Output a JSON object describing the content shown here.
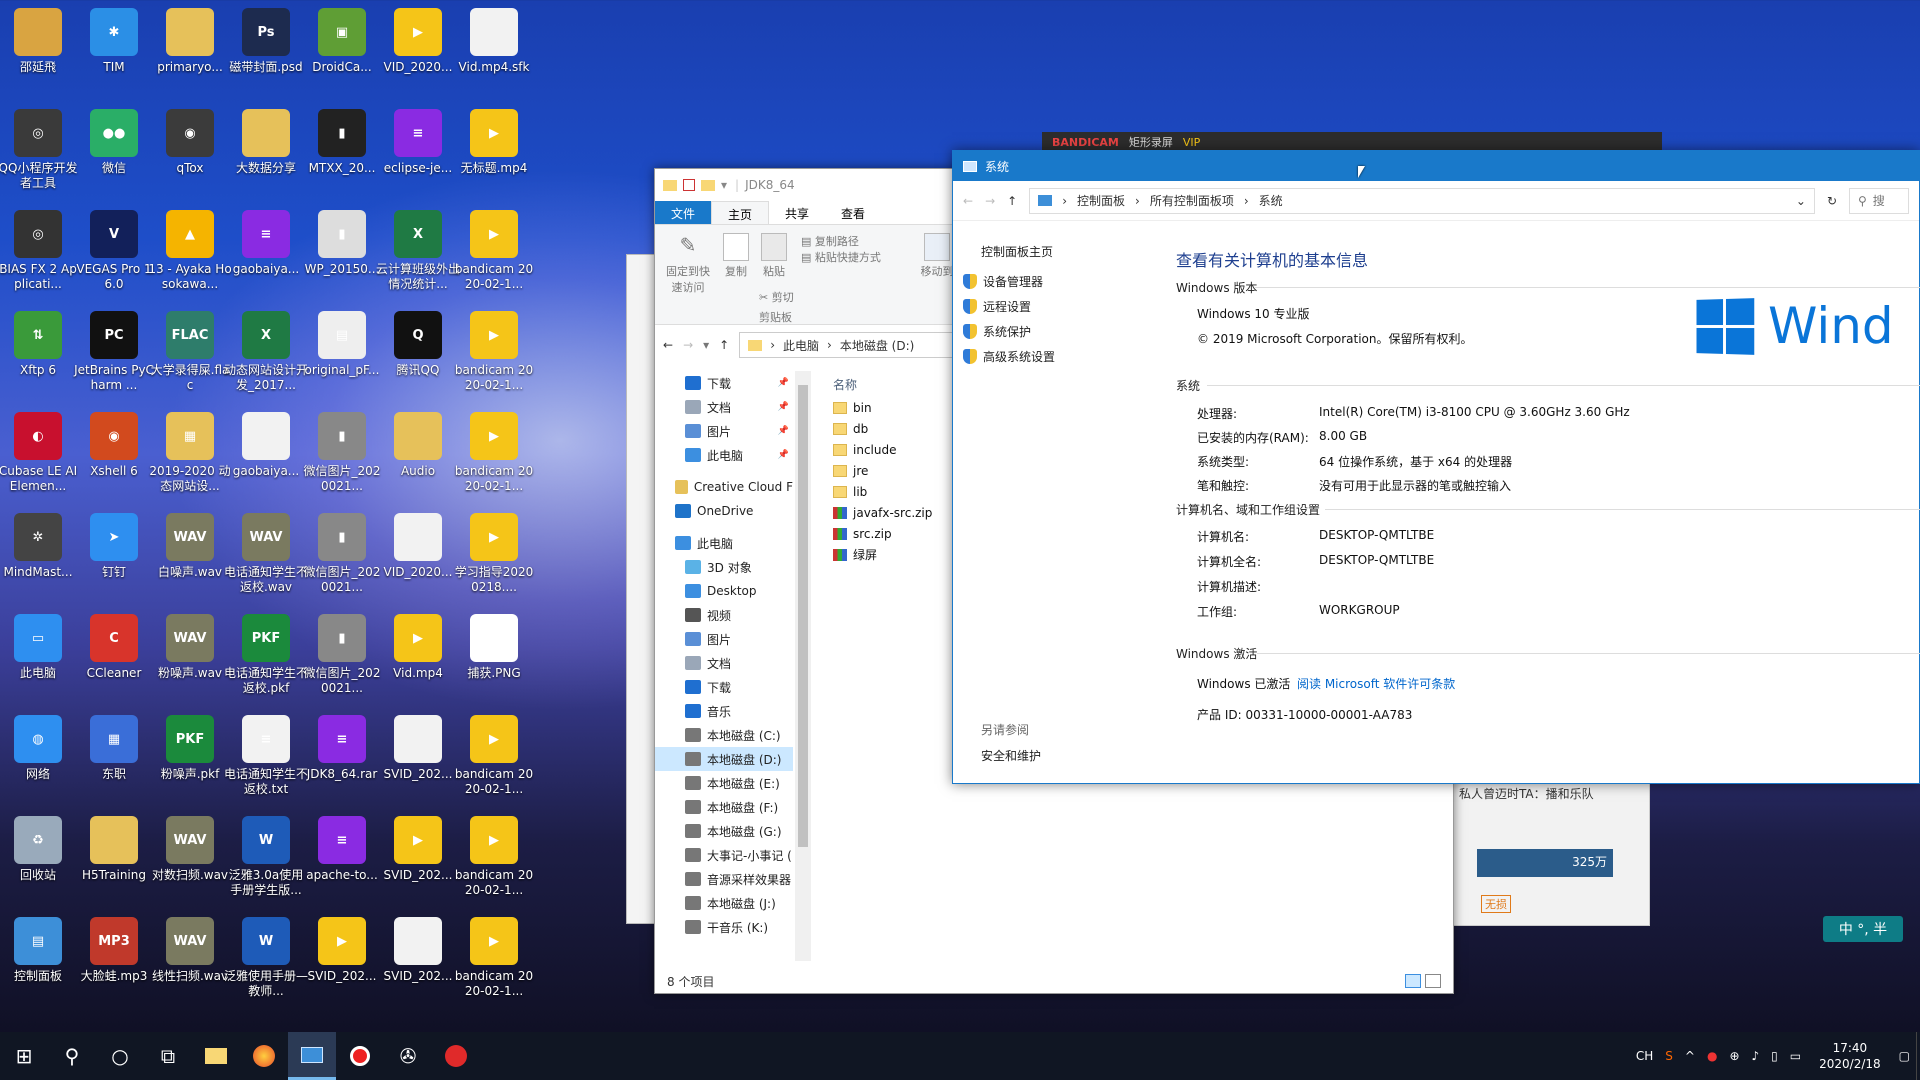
{
  "desktop_icons": [
    {
      "label": "邵延飛",
      "icon": "user-folder-icon",
      "color": "#d9a441",
      "text": ""
    },
    {
      "label": "TIM",
      "icon": "tim-icon",
      "color": "#2b8fe6",
      "text": "✱"
    },
    {
      "label": "primaryo...",
      "icon": "folder-icon",
      "color": "#e6c15a",
      "text": ""
    },
    {
      "label": "磁带封面.psd",
      "icon": "psd-file-icon",
      "color": "#1d2b4f",
      "text": "Ps"
    },
    {
      "label": "DroidCa...",
      "icon": "android-icon",
      "color": "#5f9e35",
      "text": "▣"
    },
    {
      "label": "VID_2020...",
      "icon": "player-icon",
      "color": "#f5c518",
      "text": "▶"
    },
    {
      "label": "Vid.mp4.sfk",
      "icon": "file-icon",
      "color": "#f2f2f2",
      "text": ""
    },
    {
      "label": "QQ小程序开发者工具",
      "icon": "qq-dev-icon",
      "color": "#3a3a3a",
      "text": "◎"
    },
    {
      "label": "微信",
      "icon": "wechat-icon",
      "color": "#2aae67",
      "text": "●●"
    },
    {
      "label": "qTox",
      "icon": "qtox-icon",
      "color": "#3b3b3b",
      "text": "◉"
    },
    {
      "label": "大数据分享",
      "icon": "folder-icon",
      "color": "#e6c15a",
      "text": ""
    },
    {
      "label": "MTXX_20...",
      "icon": "image-icon",
      "color": "#222",
      "text": "▮"
    },
    {
      "label": "eclipse-je...",
      "icon": "winrar-icon",
      "color": "#8a2be2",
      "text": "≡"
    },
    {
      "label": "无标题.mp4",
      "icon": "player-icon",
      "color": "#f5c518",
      "text": "▶"
    },
    {
      "label": "BIAS FX 2 Applicati...",
      "icon": "bias-icon",
      "color": "#333",
      "text": "◎"
    },
    {
      "label": "VEGAS Pro 16.0",
      "icon": "vegas-icon",
      "color": "#12205a",
      "text": "V"
    },
    {
      "label": "13 - Ayaka Hosokawa...",
      "icon": "audio-icon",
      "color": "#f5b400",
      "text": "▲"
    },
    {
      "label": "gaobaiya...",
      "icon": "winrar-icon",
      "color": "#8a2be2",
      "text": "≡"
    },
    {
      "label": "WP_20150...",
      "icon": "image-icon",
      "color": "#ddd",
      "text": "▮"
    },
    {
      "label": "云计算班级外出情况统计...",
      "icon": "excel-icon",
      "color": "#1f7a44",
      "text": "X"
    },
    {
      "label": "bandicam 2020-02-1...",
      "icon": "player-icon",
      "color": "#f5c518",
      "text": "▶"
    },
    {
      "label": "Xftp 6",
      "icon": "xftp-icon",
      "color": "#3a9a3a",
      "text": "⇅"
    },
    {
      "label": "JetBrains PyCharm ...",
      "icon": "pycharm-icon",
      "color": "#111",
      "text": "PC"
    },
    {
      "label": "大学录得屎.flac",
      "icon": "flac-icon",
      "color": "#2e7d6b",
      "text": "FLAC"
    },
    {
      "label": "动态网站设计开发_2017...",
      "icon": "excel-icon",
      "color": "#1f7a44",
      "text": "X"
    },
    {
      "label": "original_pF...",
      "icon": "image-icon",
      "color": "#eee",
      "text": "▤"
    },
    {
      "label": "腾讯QQ",
      "icon": "qq-icon",
      "color": "#111",
      "text": "Q"
    },
    {
      "label": "bandicam 2020-02-1...",
      "icon": "player-icon",
      "color": "#f5c518",
      "text": "▶"
    },
    {
      "label": "Cubase LE AI Elemen...",
      "icon": "cubase-icon",
      "color": "#c8102e",
      "text": "◐"
    },
    {
      "label": "Xshell 6",
      "icon": "xshell-icon",
      "color": "#d24a1e",
      "text": "◉"
    },
    {
      "label": "2019-2020 动态网站设...",
      "icon": "archive-icon",
      "color": "#e6c15a",
      "text": "▦"
    },
    {
      "label": "gaobaiya...",
      "icon": "file-icon",
      "color": "#f2f2f2",
      "text": ""
    },
    {
      "label": "微信图片_2020021...",
      "icon": "image-icon",
      "color": "#888",
      "text": "▮"
    },
    {
      "label": "Audio",
      "icon": "folder-icon",
      "color": "#e6c15a",
      "text": ""
    },
    {
      "label": "bandicam 2020-02-1...",
      "icon": "player-icon",
      "color": "#f5c518",
      "text": "▶"
    },
    {
      "label": "MindMast...",
      "icon": "mindmaster-icon",
      "color": "#444",
      "text": "✲"
    },
    {
      "label": "钉钉",
      "icon": "dingtalk-icon",
      "color": "#2e8ff0",
      "text": "➤"
    },
    {
      "label": "白噪声.wav",
      "icon": "wav-icon",
      "color": "#7a7a60",
      "text": "WAV"
    },
    {
      "label": "电话通知学生不返校.wav",
      "icon": "wav-icon",
      "color": "#7a7a60",
      "text": "WAV"
    },
    {
      "label": "微信图片_2020021...",
      "icon": "image-icon",
      "color": "#888",
      "text": "▮"
    },
    {
      "label": "VID_2020...",
      "icon": "file-icon",
      "color": "#f2f2f2",
      "text": ""
    },
    {
      "label": "学习指导20200218....",
      "icon": "player-icon",
      "color": "#f5c518",
      "text": "▶"
    },
    {
      "label": "此电脑",
      "icon": "this-pc-icon",
      "color": "#2e8ff0",
      "text": "▭"
    },
    {
      "label": "CCleaner",
      "icon": "ccleaner-icon",
      "color": "#d8342b",
      "text": "C"
    },
    {
      "label": "粉噪声.wav",
      "icon": "wav-icon",
      "color": "#7a7a60",
      "text": "WAV"
    },
    {
      "label": "电话通知学生不返校.pkf",
      "icon": "pkf-icon",
      "color": "#1b8a3c",
      "text": "PKF"
    },
    {
      "label": "微信图片_2020021...",
      "icon": "image-icon",
      "color": "#888",
      "text": "▮"
    },
    {
      "label": "Vid.mp4",
      "icon": "player-icon",
      "color": "#f5c518",
      "text": "▶"
    },
    {
      "label": "捕获.PNG",
      "icon": "image-icon",
      "color": "#fff",
      "text": "▭"
    },
    {
      "label": "网络",
      "icon": "network-icon",
      "color": "#2e8ff0",
      "text": "◍"
    },
    {
      "label": "东职",
      "icon": "app-icon",
      "color": "#3a6ed8",
      "text": "▦"
    },
    {
      "label": "粉噪声.pkf",
      "icon": "pkf-icon",
      "color": "#1b8a3c",
      "text": "PKF"
    },
    {
      "label": "电话通知学生不返校.txt",
      "icon": "text-file-icon",
      "color": "#f2f2f2",
      "text": "≡"
    },
    {
      "label": "JDK8_64.rar",
      "icon": "winrar-icon",
      "color": "#8a2be2",
      "text": "≡"
    },
    {
      "label": "SVID_202...",
      "icon": "file-icon",
      "color": "#f2f2f2",
      "text": ""
    },
    {
      "label": "bandicam 2020-02-1...",
      "icon": "player-icon",
      "color": "#f5c518",
      "text": "▶"
    },
    {
      "label": "回收站",
      "icon": "recycle-bin-icon",
      "color": "#9ab",
      "text": "♻"
    },
    {
      "label": "H5Training",
      "icon": "folder-icon",
      "color": "#e6c15a",
      "text": ""
    },
    {
      "label": "对数扫频.wav",
      "icon": "wav-icon",
      "color": "#7a7a60",
      "text": "WAV"
    },
    {
      "label": "泛雅3.0a使用手册学生版...",
      "icon": "word-icon",
      "color": "#1e5bb8",
      "text": "W"
    },
    {
      "label": "apache-to...",
      "icon": "winrar-icon",
      "color": "#8a2be2",
      "text": "≡"
    },
    {
      "label": "SVID_202...",
      "icon": "player-icon",
      "color": "#f5c518",
      "text": "▶"
    },
    {
      "label": "bandicam 2020-02-1...",
      "icon": "player-icon",
      "color": "#f5c518",
      "text": "▶"
    },
    {
      "label": "控制面板",
      "icon": "control-panel-icon",
      "color": "#3d8fd8",
      "text": "▤"
    },
    {
      "label": "大脸蛙.mp3",
      "icon": "mp3-icon",
      "color": "#c0392b",
      "text": "MP3"
    },
    {
      "label": "线性扫频.wav",
      "icon": "wav-icon",
      "color": "#7a7a60",
      "text": "WAV"
    },
    {
      "label": "泛雅使用手册—教师...",
      "icon": "word-icon",
      "color": "#1e5bb8",
      "text": "W"
    },
    {
      "label": "SVID_202...",
      "icon": "player-icon",
      "color": "#f5c518",
      "text": "▶"
    },
    {
      "label": "SVID_202...",
      "icon": "file-icon",
      "color": "#f2f2f2",
      "text": ""
    },
    {
      "label": "bandicam 2020-02-1...",
      "icon": "player-icon",
      "color": "#f5c518",
      "text": "▶"
    }
  ],
  "explorer": {
    "title": "JDK8_64",
    "tabs": [
      "文件",
      "主页",
      "共享",
      "查看"
    ],
    "ribbon": {
      "pin": "固定到快速访问",
      "copy": "复制",
      "paste": "粘贴",
      "copy_path": "复制路径",
      "paste_shortcut": "粘贴快捷方式",
      "cut": "剪切",
      "move_to": "移动到",
      "group_clipboard": "剪贴板"
    },
    "address": [
      "此电脑",
      "本地磁盘 (D:)"
    ],
    "nav": [
      {
        "label": "下载",
        "icon": "download-icon",
        "color": "#1f6fd0",
        "pinned": true,
        "sel": false
      },
      {
        "label": "文档",
        "icon": "documents-icon",
        "color": "#9aa7b8",
        "pinned": true,
        "sel": false
      },
      {
        "label": "图片",
        "icon": "pictures-icon",
        "color": "#5a8fd6",
        "pinned": true,
        "sel": false
      },
      {
        "label": "此电脑",
        "icon": "this-pc-icon",
        "color": "#3c8fe0",
        "pinned": true,
        "sel": false
      },
      {
        "label": "Creative Cloud F",
        "icon": "folder-icon",
        "color": "#e6c15a",
        "pinned": false,
        "sel": false
      },
      {
        "label": "OneDrive",
        "icon": "onedrive-icon",
        "color": "#1e73c9",
        "pinned": false,
        "sel": false
      },
      {
        "label": "此电脑",
        "icon": "this-pc-icon",
        "color": "#3c8fe0",
        "pinned": false,
        "sel": false
      },
      {
        "label": "3D 对象",
        "icon": "3d-objects-icon",
        "color": "#5ab2e6",
        "pinned": false,
        "sel": false
      },
      {
        "label": "Desktop",
        "icon": "desktop-icon",
        "color": "#3c8fe0",
        "pinned": false,
        "sel": false
      },
      {
        "label": "视频",
        "icon": "videos-icon",
        "color": "#555",
        "pinned": false,
        "sel": false
      },
      {
        "label": "图片",
        "icon": "pictures-icon",
        "color": "#5a8fd6",
        "pinned": false,
        "sel": false
      },
      {
        "label": "文档",
        "icon": "documents-icon",
        "color": "#9aa7b8",
        "pinned": false,
        "sel": false
      },
      {
        "label": "下载",
        "icon": "download-icon",
        "color": "#1f6fd0",
        "pinned": false,
        "sel": false
      },
      {
        "label": "音乐",
        "icon": "music-icon",
        "color": "#1f6fd0",
        "pinned": false,
        "sel": false
      },
      {
        "label": "本地磁盘 (C:)",
        "icon": "drive-icon",
        "color": "#777",
        "pinned": false,
        "sel": false
      },
      {
        "label": "本地磁盘 (D:)",
        "icon": "drive-icon",
        "color": "#777",
        "pinned": false,
        "sel": true
      },
      {
        "label": "本地磁盘 (E:)",
        "icon": "drive-icon",
        "color": "#777",
        "pinned": false,
        "sel": false
      },
      {
        "label": "本地磁盘 (F:)",
        "icon": "drive-icon",
        "color": "#777",
        "pinned": false,
        "sel": false
      },
      {
        "label": "本地磁盘 (G:)",
        "icon": "drive-icon",
        "color": "#777",
        "pinned": false,
        "sel": false
      },
      {
        "label": "大事记-小事记 (",
        "icon": "drive-icon",
        "color": "#777",
        "pinned": false,
        "sel": false
      },
      {
        "label": "音源采样效果器",
        "icon": "drive-icon",
        "color": "#777",
        "pinned": false,
        "sel": false
      },
      {
        "label": "本地磁盘 (J:)",
        "icon": "drive-icon",
        "color": "#777",
        "pinned": false,
        "sel": false
      },
      {
        "label": "干音乐 (K:)",
        "icon": "drive-icon",
        "color": "#777",
        "pinned": false,
        "sel": false
      }
    ],
    "column_name": "名称",
    "files": [
      {
        "name": "bin",
        "type": "folder"
      },
      {
        "name": "db",
        "type": "folder"
      },
      {
        "name": "include",
        "type": "folder"
      },
      {
        "name": "jre",
        "type": "folder"
      },
      {
        "name": "lib",
        "type": "folder"
      },
      {
        "name": "javafx-src.zip",
        "type": "zip"
      },
      {
        "name": "src.zip",
        "type": "zip"
      },
      {
        "name": "绿屏",
        "type": "zip"
      }
    ],
    "status": "8 个项目"
  },
  "system": {
    "title": "系统",
    "address": [
      "控制面板",
      "所有控制面板项",
      "系统"
    ],
    "search_placeholder": "搜",
    "left": {
      "home": "控制面板主页",
      "links": [
        "设备管理器",
        "远程设置",
        "系统保护",
        "高级系统设置"
      ],
      "see_also": "另请参阅",
      "security": "安全和维护"
    },
    "heading": "查看有关计算机的基本信息",
    "edition_section": "Windows 版本",
    "edition": "Windows 10 专业版",
    "copyright": "© 2019 Microsoft Corporation。保留所有权利。",
    "logo_text": "Wind",
    "system_section": "系统",
    "specs": [
      {
        "k": "处理器:",
        "v": "Intel(R) Core(TM) i3-8100 CPU @ 3.60GHz   3.60 GHz"
      },
      {
        "k": "已安装的内存(RAM):",
        "v": "8.00 GB"
      },
      {
        "k": "系统类型:",
        "v": "64 位操作系统，基于 x64 的处理器"
      },
      {
        "k": "笔和触控:",
        "v": "没有可用于此显示器的笔或触控输入"
      }
    ],
    "name_section": "计算机名、域和工作组设置",
    "names": [
      {
        "k": "计算机名:",
        "v": "DESKTOP-QMTLTBE"
      },
      {
        "k": "计算机全名:",
        "v": "DESKTOP-QMTLTBE"
      },
      {
        "k": "计算机描述:",
        "v": ""
      },
      {
        "k": "工作组:",
        "v": "WORKGROUP"
      }
    ],
    "activation_section": "Windows 激活",
    "activated": "Windows 已激活",
    "license_link": "阅读 Microsoft 软件许可条款",
    "product_id": "产品 ID: 00331-10000-00001-AA783"
  },
  "bandicam": {
    "title": "BANDICAM",
    "mode": "矩形录屏",
    "vip": "VIP"
  },
  "bg_window": {
    "text": "私人曾迈时TA：播和乐队",
    "views": "325万",
    "free": "无损"
  },
  "ime": {
    "label": "中 °, 半"
  },
  "taskbar": {
    "lang": "CH",
    "time": "17:40",
    "date": "2020/2/18"
  }
}
